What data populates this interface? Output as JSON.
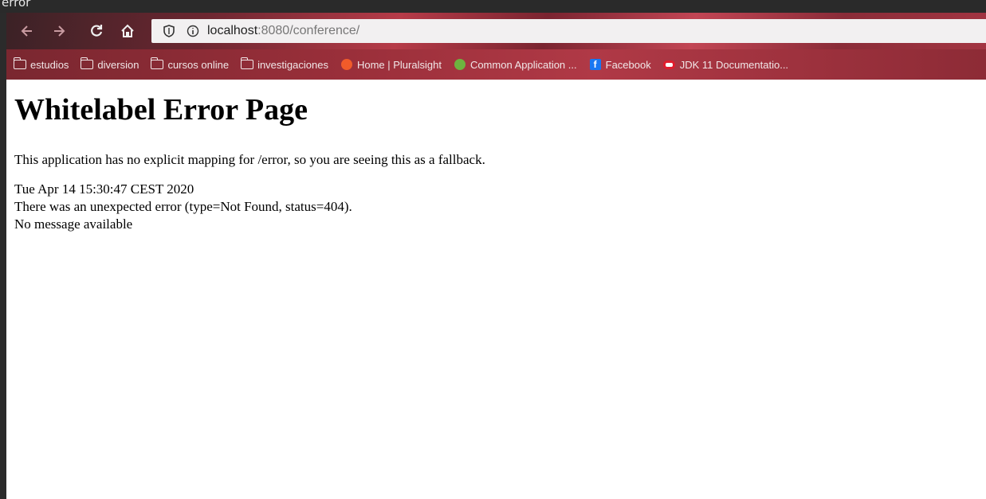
{
  "window": {
    "title_fragment": "error"
  },
  "toolbar": {
    "back_icon": "arrow-left-icon",
    "forward_icon": "arrow-right-icon",
    "reload_icon": "reload-icon",
    "home_icon": "home-icon"
  },
  "urlbar": {
    "host": "localhost",
    "rest": ":8080/conference/",
    "shield_icon": "shield-icon",
    "info_icon": "info-icon"
  },
  "bookmarks": [
    {
      "label": "estudios",
      "icon": "folder-icon"
    },
    {
      "label": "diversion",
      "icon": "folder-icon"
    },
    {
      "label": "cursos online",
      "icon": "folder-icon"
    },
    {
      "label": "investigaciones",
      "icon": "folder-icon"
    },
    {
      "label": "Home | Pluralsight",
      "icon": "pluralsight-icon",
      "color": "#f15b2a"
    },
    {
      "label": "Common Application ...",
      "icon": "spring-leaf-icon",
      "color": "#6db33f"
    },
    {
      "label": "Facebook",
      "icon": "facebook-icon",
      "color": "#1877f2"
    },
    {
      "label": "JDK 11 Documentatio...",
      "icon": "oracle-icon",
      "color": "#e11d2d"
    }
  ],
  "page": {
    "heading": "Whitelabel Error Page",
    "description": "This application has no explicit mapping for /error, so you are seeing this as a fallback.",
    "timestamp": "Tue Apr 14 15:30:47 CEST 2020",
    "error_line": "There was an unexpected error (type=Not Found, status=404).",
    "message": "No message available"
  }
}
